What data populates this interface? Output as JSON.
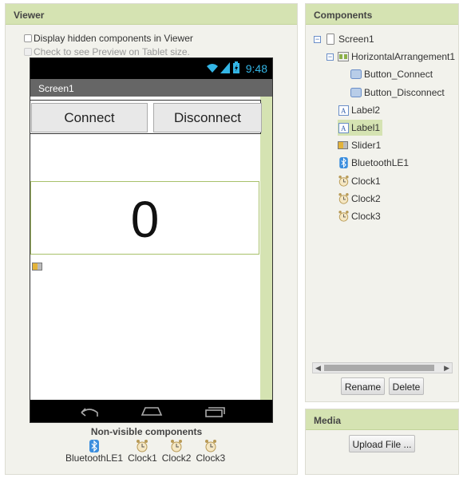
{
  "viewer": {
    "header": "Viewer",
    "display_hidden_label": "Display hidden components in Viewer",
    "tablet_preview_label": "Check to see Preview on Tablet size.",
    "phone": {
      "time": "9:48",
      "screen_title": "Screen1",
      "connect_label": "Connect",
      "disconnect_label": "Disconnect",
      "label1_text": "0"
    },
    "nonvisible": {
      "title": "Non-visible components",
      "items": [
        {
          "label": "BluetoothLE1",
          "icon": "bluetooth-icon"
        },
        {
          "label": "Clock1",
          "icon": "clock-icon"
        },
        {
          "label": "Clock2",
          "icon": "clock-icon"
        },
        {
          "label": "Clock3",
          "icon": "clock-icon"
        }
      ]
    }
  },
  "components": {
    "header": "Components",
    "tree": [
      {
        "label": "Screen1",
        "icon": "screen-icon"
      },
      {
        "label": "HorizontalArrangement1",
        "icon": "arrangement-icon"
      },
      {
        "label": "Button_Connect",
        "icon": "button-icon"
      },
      {
        "label": "Button_Disconnect",
        "icon": "button-icon"
      },
      {
        "label": "Label2",
        "icon": "label-icon"
      },
      {
        "label": "Label1",
        "icon": "label-icon",
        "selected": true
      },
      {
        "label": "Slider1",
        "icon": "slider-icon"
      },
      {
        "label": "BluetoothLE1",
        "icon": "bluetooth-icon"
      },
      {
        "label": "Clock1",
        "icon": "clock-icon"
      },
      {
        "label": "Clock2",
        "icon": "clock-icon"
      },
      {
        "label": "Clock3",
        "icon": "clock-icon"
      }
    ],
    "rename_label": "Rename",
    "delete_label": "Delete"
  },
  "media": {
    "header": "Media",
    "upload_label": "Upload File ..."
  },
  "colors": {
    "header_green": "#d5e3b2",
    "selection": "#d5e3b2",
    "time_blue": "#33b5e5"
  }
}
